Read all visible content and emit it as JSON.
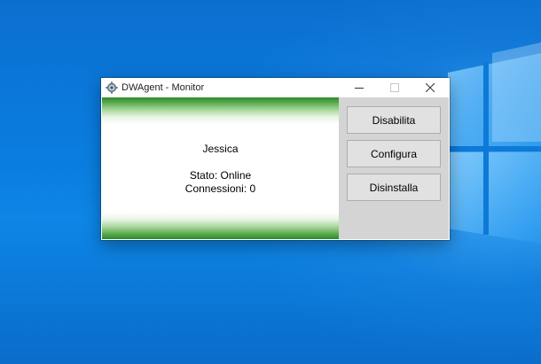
{
  "window": {
    "title": "DWAgent - Monitor"
  },
  "agent": {
    "name": "Jessica",
    "status": "Stato: Online",
    "connections": "Connessioni: 0"
  },
  "actions": {
    "disable_label": "Disabilita",
    "configure_label": "Configura",
    "uninstall_label": "Disinstalla"
  },
  "colors": {
    "desktop_blue": "#0a6fcf",
    "banner_green": "#2b8a2b",
    "side_panel_gray": "#d4d4d4"
  }
}
